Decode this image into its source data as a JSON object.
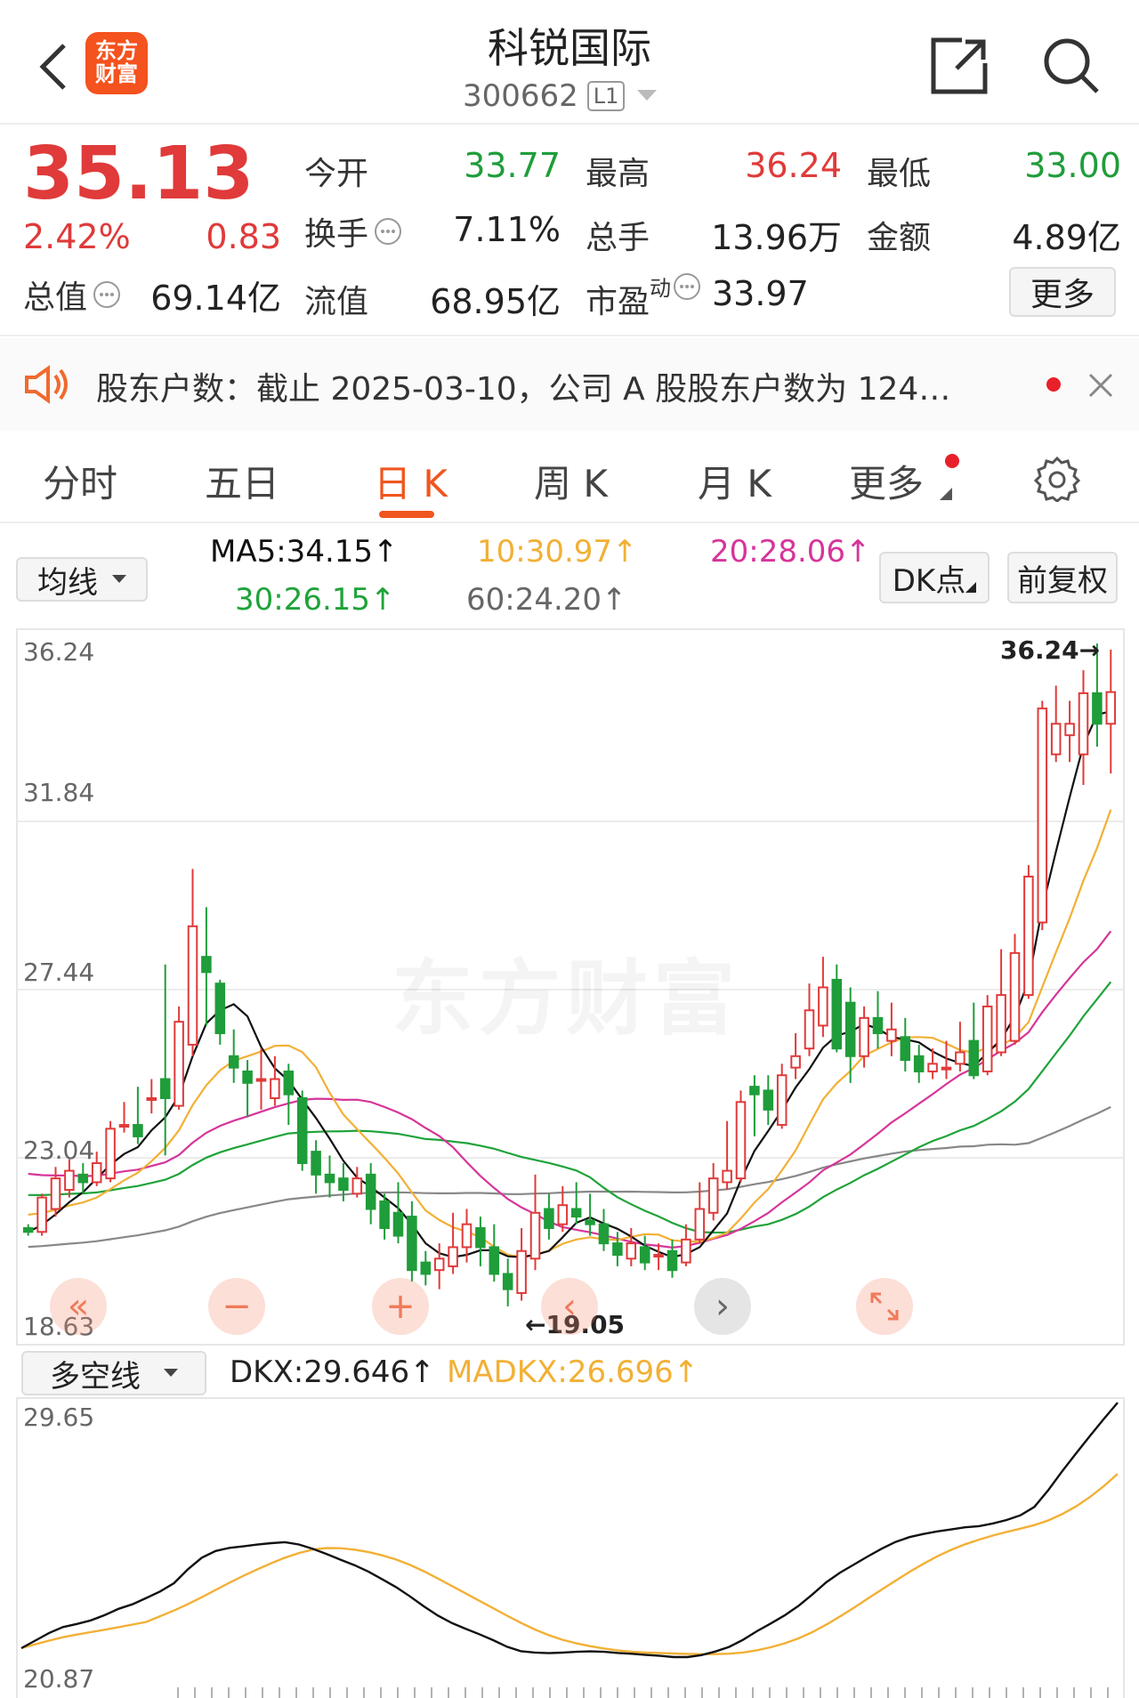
{
  "header": {
    "back_icon": "chevron-left-icon",
    "logo_line1": "东方",
    "logo_line2": "财富",
    "stock_name": "科锐国际",
    "stock_code": "300662",
    "level_badge": "L1",
    "share_icon": "share-icon",
    "search_icon": "search-icon"
  },
  "quote": {
    "price": "35.13",
    "change_pct": "2.42%",
    "change_amt": "0.83",
    "total_value_label": "总值",
    "total_value": "69.14亿",
    "stats": [
      {
        "label": "今开",
        "value": "33.77",
        "color": "#1f9d3a"
      },
      {
        "label": "最高",
        "value": "36.24",
        "color": "#e03a3a"
      },
      {
        "label": "最低",
        "value": "33.00",
        "color": "#1f9d3a"
      },
      {
        "label": "换手",
        "value": "7.11%",
        "color": "#222222"
      },
      {
        "label": "总手",
        "value": "13.96万",
        "color": "#222222"
      },
      {
        "label": "金额",
        "value": "4.89亿",
        "color": "#222222"
      },
      {
        "label": "流值",
        "value": "68.95亿",
        "color": "#222222"
      },
      {
        "label": "市盈",
        "value": "33.97",
        "color": "#222222"
      }
    ],
    "pe_superscript": "动",
    "more_button": "更多"
  },
  "notice": {
    "text": "股东户数：截止 2025-03-10，公司 A 股股东户数为 124…",
    "speaker_icon": "speaker-icon",
    "close_icon": "close-icon"
  },
  "tabs": [
    "分时",
    "五日",
    "日 K",
    "周 K",
    "月 K",
    "更多"
  ],
  "active_tab": 2,
  "settings_icon": "gear-icon",
  "ma_bar": {
    "selector": "均线",
    "ma5": "MA5:34.15↑",
    "ma10": "10:30.97↑",
    "ma20": "20:28.06↑",
    "ma30": "30:26.15↑",
    "ma60": "60:24.20↑",
    "dk_button": "DK点",
    "adjust_button": "前复权"
  },
  "main_chart": {
    "y_labels": [
      "36.24",
      "31.84",
      "27.44",
      "23.04",
      "18.63"
    ],
    "high_marker": "36.24→",
    "low_marker": "←19.05",
    "watermark": "东方财富"
  },
  "indicator_bar": {
    "selector": "多空线",
    "dkx": "DKX:29.646↑",
    "madkx": "MADKX:26.696↑"
  },
  "indicator_chart": {
    "y_labels": [
      "29.65",
      "20.87"
    ]
  },
  "colors": {
    "up": "#e03a3a",
    "down": "#1f9d3a",
    "accent": "#f0561e",
    "ma5": "#111111",
    "ma10": "#f2b035",
    "ma20": "#d6359a",
    "ma30": "#1fa33a",
    "ma60": "#888888"
  },
  "chart_data": {
    "type": "candlestick",
    "title": "",
    "ylim": [
      18.63,
      36.24
    ],
    "candles": [
      [
        21.1,
        21.0,
        21.2,
        20.9
      ],
      [
        21.0,
        21.9,
        22.0,
        20.9
      ],
      [
        21.6,
        22.4,
        22.7,
        21.4
      ],
      [
        22.1,
        22.6,
        22.9,
        21.9
      ],
      [
        22.5,
        22.3,
        22.8,
        22.0
      ],
      [
        22.3,
        22.8,
        23.1,
        22.2
      ],
      [
        22.4,
        23.7,
        23.9,
        22.3
      ],
      [
        23.8,
        23.8,
        24.4,
        23.6
      ],
      [
        23.8,
        23.5,
        24.8,
        23.3
      ],
      [
        24.5,
        24.5,
        25.0,
        24.1
      ],
      [
        25.0,
        24.5,
        28.0,
        23.0
      ],
      [
        24.3,
        26.5,
        26.9,
        24.2
      ],
      [
        25.9,
        29.0,
        30.5,
        25.6
      ],
      [
        28.2,
        27.8,
        29.5,
        26.4
      ],
      [
        27.5,
        26.2,
        27.6,
        25.9
      ],
      [
        25.6,
        25.3,
        26.3,
        24.9
      ],
      [
        25.2,
        24.9,
        25.5,
        24.0
      ],
      [
        25.0,
        25.0,
        25.8,
        24.2
      ],
      [
        24.5,
        25.0,
        25.6,
        24.3
      ],
      [
        25.2,
        24.6,
        25.4,
        23.8
      ],
      [
        24.5,
        22.8,
        24.7,
        22.6
      ],
      [
        23.1,
        22.5,
        23.4,
        22.0
      ],
      [
        22.5,
        22.3,
        23.0,
        21.9
      ],
      [
        22.4,
        22.1,
        22.8,
        21.8
      ],
      [
        22.0,
        22.4,
        22.7,
        21.9
      ],
      [
        22.5,
        21.6,
        22.8,
        21.2
      ],
      [
        21.8,
        21.1,
        22.0,
        20.8
      ],
      [
        21.5,
        20.9,
        22.3,
        20.7
      ],
      [
        21.4,
        20.0,
        21.8,
        19.7
      ],
      [
        20.2,
        19.9,
        20.5,
        19.6
      ],
      [
        20.0,
        20.3,
        20.7,
        19.5
      ],
      [
        20.1,
        20.6,
        21.5,
        19.9
      ],
      [
        20.6,
        21.2,
        21.6,
        20.2
      ],
      [
        21.1,
        20.6,
        21.4,
        20.1
      ],
      [
        20.6,
        19.9,
        21.2,
        19.7
      ],
      [
        19.9,
        19.5,
        20.3,
        19.05
      ],
      [
        19.4,
        20.5,
        21.1,
        19.2
      ],
      [
        20.3,
        21.5,
        22.5,
        20.0
      ],
      [
        21.6,
        21.1,
        22.0,
        20.8
      ],
      [
        21.2,
        21.7,
        22.2,
        21.0
      ],
      [
        21.6,
        21.4,
        22.3,
        21.2
      ],
      [
        21.3,
        21.2,
        22.0,
        20.9
      ],
      [
        21.2,
        20.7,
        21.6,
        20.5
      ],
      [
        20.7,
        20.4,
        21.0,
        20.1
      ],
      [
        20.3,
        20.7,
        21.1,
        20.1
      ],
      [
        20.6,
        20.2,
        20.9,
        20.0
      ],
      [
        20.4,
        20.4,
        20.7,
        20.0
      ],
      [
        20.5,
        20.0,
        20.8,
        19.8
      ],
      [
        20.2,
        20.8,
        21.2,
        20.1
      ],
      [
        20.8,
        21.6,
        22.3,
        20.7
      ],
      [
        21.5,
        22.4,
        22.8,
        21.3
      ],
      [
        22.3,
        22.6,
        23.9,
        22.1
      ],
      [
        22.4,
        24.4,
        24.7,
        22.3
      ],
      [
        24.8,
        24.6,
        25.1,
        23.5
      ],
      [
        24.7,
        24.2,
        25.1,
        23.8
      ],
      [
        23.8,
        25.1,
        25.4,
        23.7
      ],
      [
        25.3,
        25.6,
        26.2,
        25.0
      ],
      [
        25.8,
        26.8,
        27.5,
        25.6
      ],
      [
        26.4,
        27.4,
        28.2,
        26.1
      ],
      [
        27.6,
        25.8,
        28.0,
        25.7
      ],
      [
        27.0,
        25.6,
        27.4,
        24.9
      ],
      [
        25.6,
        26.6,
        26.9,
        25.3
      ],
      [
        26.6,
        26.2,
        27.3,
        25.8
      ],
      [
        26.0,
        26.3,
        27.0,
        25.6
      ],
      [
        26.1,
        25.5,
        26.6,
        25.2
      ],
      [
        25.6,
        25.2,
        25.9,
        24.9
      ],
      [
        25.2,
        25.4,
        25.8,
        25.0
      ],
      [
        25.3,
        25.3,
        26.0,
        25.0
      ],
      [
        25.4,
        25.7,
        26.5,
        25.2
      ],
      [
        26.0,
        25.1,
        27.0,
        25.0
      ],
      [
        25.2,
        26.9,
        27.2,
        25.1
      ],
      [
        25.7,
        27.2,
        28.4,
        25.6
      ],
      [
        26.0,
        28.3,
        28.8,
        25.9
      ],
      [
        27.2,
        30.3,
        30.6,
        27.1
      ],
      [
        29.1,
        34.7,
        34.9,
        28.9
      ],
      [
        33.5,
        34.3,
        35.3,
        33.3
      ],
      [
        34.0,
        34.3,
        34.9,
        33.3
      ],
      [
        33.5,
        35.1,
        35.7,
        32.7
      ],
      [
        35.1,
        34.3,
        36.4,
        33.7
      ],
      [
        34.3,
        35.13,
        36.24,
        33.0
      ]
    ],
    "ma5_end": 34.15,
    "ma10_end": 30.97,
    "ma20_end": 28.06,
    "ma30_end": 26.15,
    "ma60_end": 24.2,
    "dkx_end": 29.646,
    "madkx_end": 26.696,
    "indicator_ylim": [
      20.87,
      29.65
    ]
  }
}
